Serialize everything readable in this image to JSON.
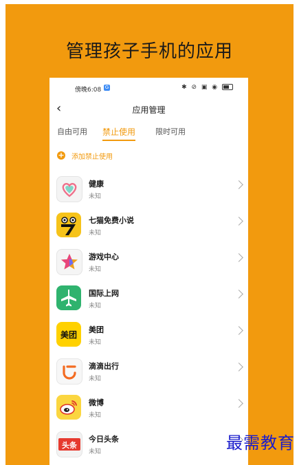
{
  "promo": {
    "title": "管理孩子手机的应用",
    "background": "#f29a0e"
  },
  "status_bar": {
    "time": "傍晚6:08",
    "notif_badge": "G",
    "icons": "✱ ⊘ ▣ ◉"
  },
  "nav": {
    "back_icon": "chevron-left-icon",
    "title": "应用管理"
  },
  "tabs": [
    {
      "label": "自由可用",
      "selected": false
    },
    {
      "label": "禁止使用",
      "selected": true
    },
    {
      "label": "限时可用",
      "selected": false
    }
  ],
  "add_action": {
    "label": "添加禁止使用",
    "icon": "plus-circle-icon"
  },
  "apps": [
    {
      "name": "健康",
      "status": "未知",
      "icon": "health-heart-icon"
    },
    {
      "name": "七猫免费小说",
      "status": "未知",
      "icon": "qimao-novel-icon"
    },
    {
      "name": "游戏中心",
      "status": "未知",
      "icon": "game-center-star-icon"
    },
    {
      "name": "国际上网",
      "status": "未知",
      "icon": "airplane-icon"
    },
    {
      "name": "美团",
      "status": "未知",
      "icon": "meituan-icon",
      "icon_text": "美团"
    },
    {
      "name": "滴滴出行",
      "status": "未知",
      "icon": "didi-icon"
    },
    {
      "name": "微博",
      "status": "未知",
      "icon": "weibo-icon"
    },
    {
      "name": "今日头条",
      "status": "未知",
      "icon": "toutiao-icon",
      "icon_text": "头条"
    }
  ],
  "watermark": "最需教育",
  "colors": {
    "accent": "#f29a0e",
    "watermark": "#1a1ccc"
  }
}
